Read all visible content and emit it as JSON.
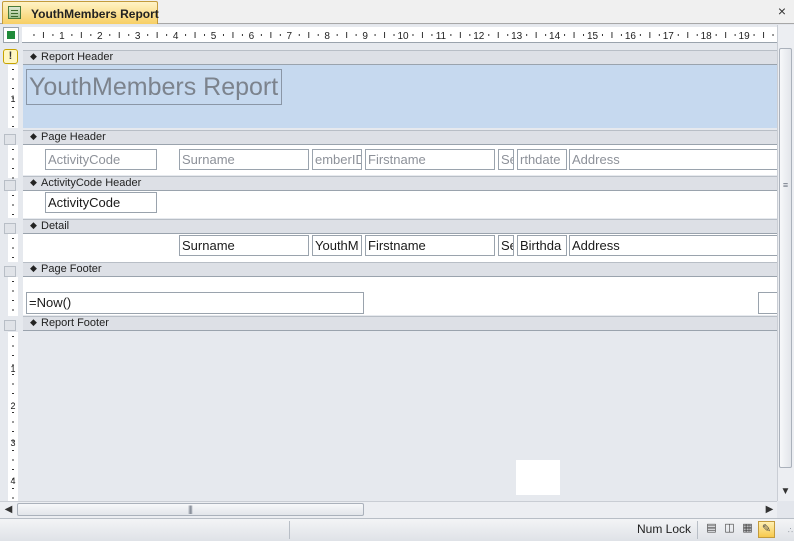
{
  "tab": {
    "title": "YouthMembers Report",
    "icon": "report-icon",
    "close": "×"
  },
  "ruler": {
    "numbers": [
      "1",
      "2",
      "3",
      "4",
      "5",
      "6",
      "7",
      "8",
      "9",
      "10",
      "11",
      "12",
      "13",
      "14",
      "15",
      "16",
      "17",
      "18",
      "19"
    ]
  },
  "sections": {
    "report_header": {
      "label": "Report Header",
      "title_text": "YouthMembers Report"
    },
    "page_header": {
      "label": "Page Header",
      "fields": [
        "ActivityCode",
        "Surname",
        "emberID",
        "Firstname",
        "Se",
        "rthdate",
        "Address"
      ]
    },
    "group_header": {
      "label": "ActivityCode Header",
      "field": "ActivityCode"
    },
    "detail": {
      "label": "Detail",
      "fields": [
        "Surname",
        "YouthM",
        "Firstname",
        "Se",
        "Birthda",
        "Address"
      ]
    },
    "page_footer": {
      "label": "Page Footer",
      "expression": "=Now()"
    },
    "report_footer": {
      "label": "Report Footer"
    }
  },
  "status": {
    "num_lock": "Num Lock"
  },
  "colors": {
    "header_band": "#c6d9ef",
    "tab_active": "#f7cf65",
    "design_bg": "#e6e9ee"
  }
}
